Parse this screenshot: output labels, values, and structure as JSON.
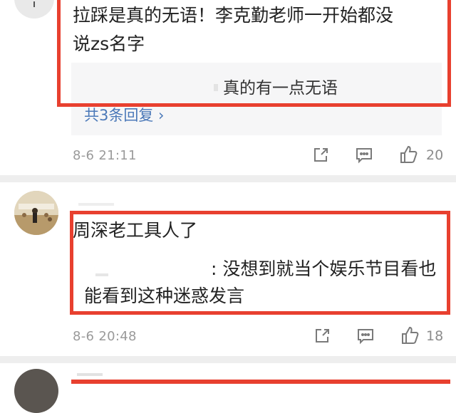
{
  "comments": [
    {
      "text_lines": [
        "拉踩是真的无语！李克勤老师一开始都没",
        "说zs名字"
      ],
      "reply_text": "真的有一点无语",
      "more_replies": "共3条回复 ›",
      "time": "8-6 21:11",
      "likes": "20"
    },
    {
      "text_lines": [
        "周深老工具人了"
      ],
      "reply_lines": [
        ": 没想到就当个娱乐节目看也",
        "能看到这种迷惑发言"
      ],
      "time": "8-6 20:48",
      "likes": "18"
    }
  ],
  "icons": {
    "share": "share-icon",
    "comment": "comment-icon",
    "like": "thumbs-up-icon"
  },
  "colors": {
    "highlight": "#e8402f",
    "link": "#4a78b8"
  }
}
